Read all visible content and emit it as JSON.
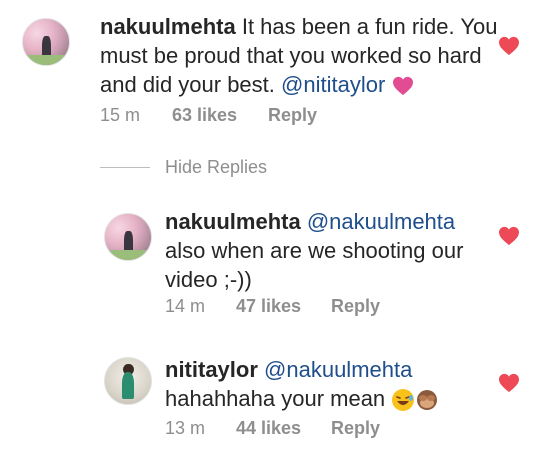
{
  "comments": [
    {
      "username": "nakuulmehta",
      "mention_prefix": "",
      "line1": "It has been a fun ride. You",
      "line2": "must be proud that you worked so hard",
      "line3": "and did your best.",
      "mention_suffix": "@nititaylor",
      "time": "15 m",
      "likes": "63 likes",
      "reply": "Reply"
    },
    {
      "username": "nakuulmehta",
      "mention_prefix": "@nakuulmehta",
      "line1": "also when are we shooting our",
      "line2": "video ;-))",
      "time": "14 m",
      "likes": "47 likes",
      "reply": "Reply"
    },
    {
      "username": "nititaylor",
      "mention_prefix": "@nakuulmehta",
      "line1": "hahahhaha your mean",
      "time": "13 m",
      "likes": "44 likes",
      "reply": "Reply"
    }
  ],
  "replies_toggle": "Hide Replies",
  "colors": {
    "heart": "#ed4956",
    "mention": "#1f4e8c",
    "meta": "#8e8e8e",
    "pink_heart": "#e24c93"
  },
  "icons": [
    "heart-icon",
    "pink-heart-emoji",
    "laughing-emoji",
    "see-no-evil-monkey-emoji"
  ]
}
